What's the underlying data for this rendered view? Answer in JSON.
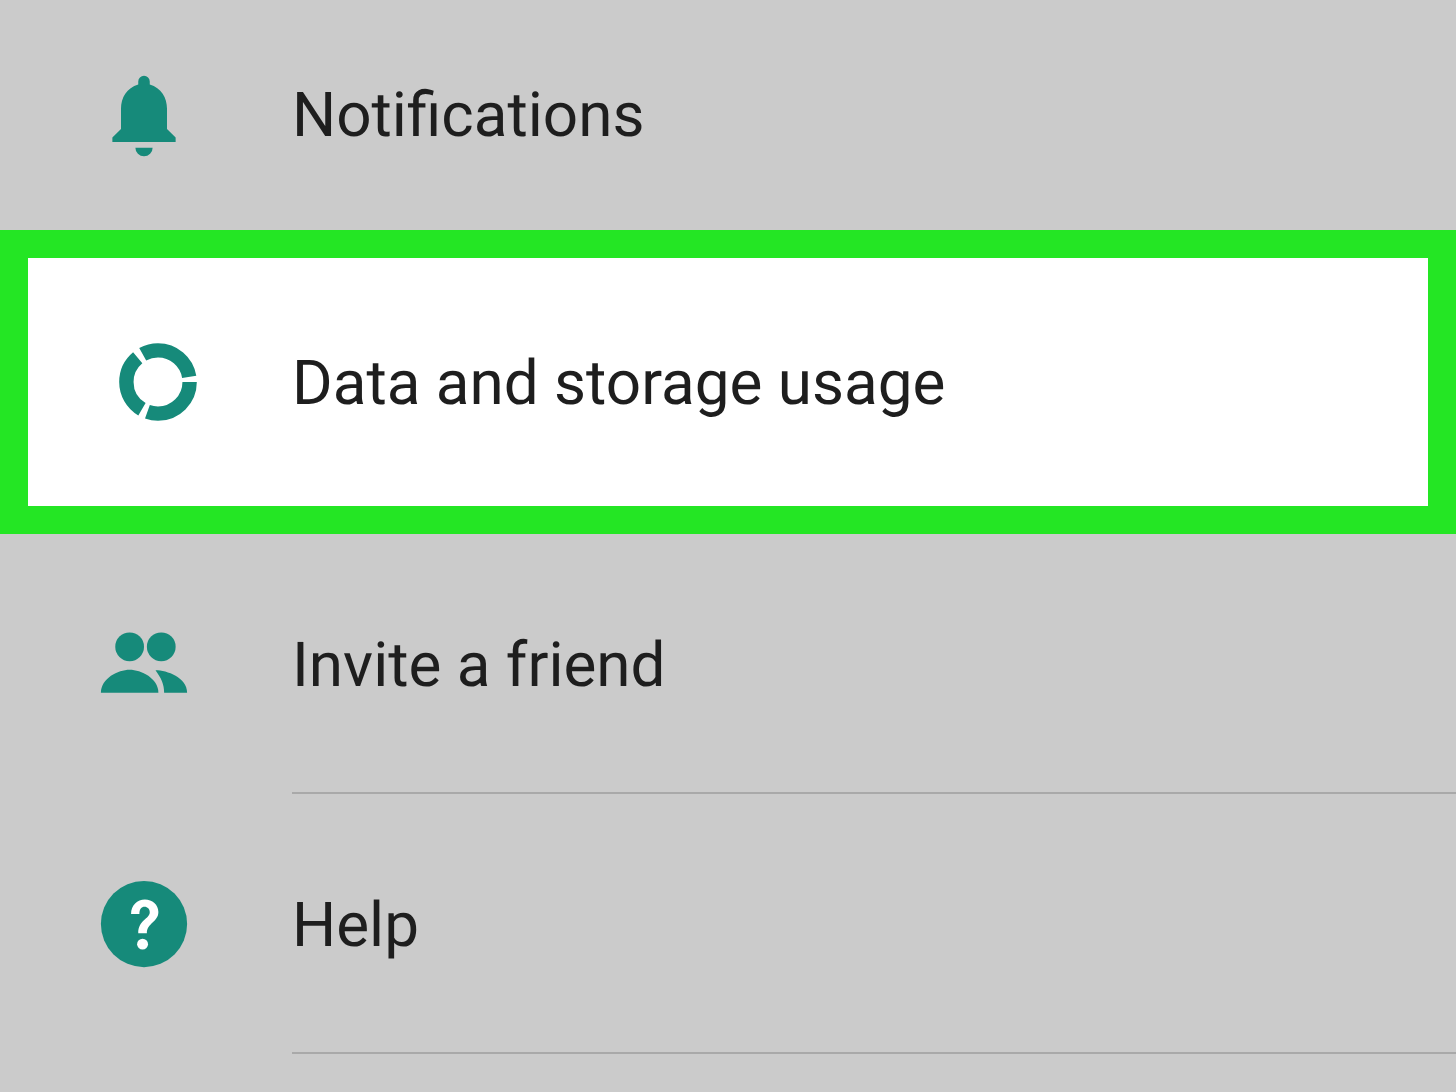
{
  "settings": {
    "items": [
      {
        "label": "Notifications",
        "highlighted": false
      },
      {
        "label": "Data and storage usage",
        "highlighted": true
      },
      {
        "label": "Invite a friend",
        "highlighted": false
      },
      {
        "label": "Help",
        "highlighted": false
      }
    ]
  }
}
